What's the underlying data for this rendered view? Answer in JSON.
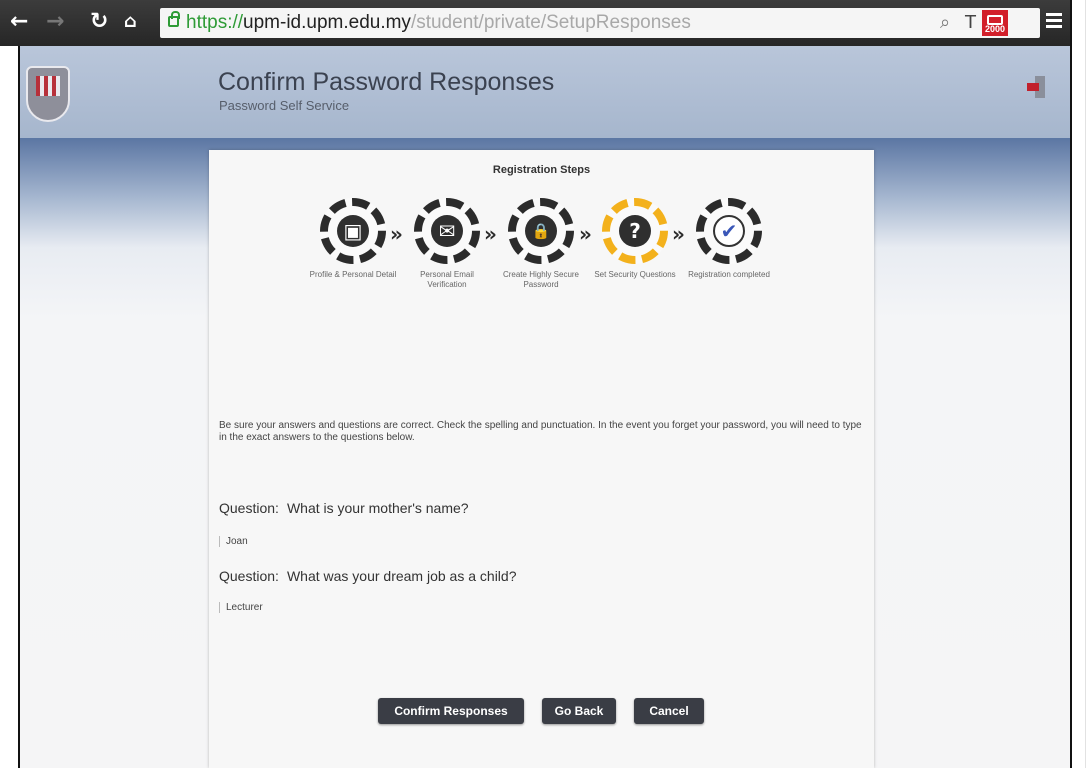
{
  "browser": {
    "url_scheme": "https://",
    "url_host": "upm-id.upm.edu.my",
    "url_path": "/student/private/SetupResponses",
    "ext_badge": "2000"
  },
  "header": {
    "title": "Confirm Password Responses",
    "subtitle": "Password Self Service"
  },
  "registration": {
    "title": "Registration Steps",
    "steps": [
      {
        "label": "Profile & Personal Detail",
        "icon": "profile-card-icon",
        "glyph": "▣",
        "state": "done"
      },
      {
        "label": "Personal Email Verification",
        "icon": "envelope-icon",
        "glyph": "✉",
        "state": "done"
      },
      {
        "label": "Create Highly Secure Password",
        "icon": "lock-shield-icon",
        "glyph": "🔒",
        "state": "done"
      },
      {
        "label": "Set Security Questions",
        "icon": "question-shield-icon",
        "glyph": "?",
        "state": "active"
      },
      {
        "label": "Registration completed",
        "icon": "checkmark-icon",
        "glyph": "✔",
        "state": "pending"
      }
    ]
  },
  "instructions": "Be sure your answers and questions are correct. Check the spelling and punctuation. In the event you forget your password, you will need to type in the exact answers to the questions below.",
  "questions": [
    {
      "prefix": "Question:",
      "text": "What is your mother's name?",
      "answer": "Joan"
    },
    {
      "prefix": "Question:",
      "text": "What was your dream job as a child?",
      "answer": "Lecturer"
    }
  ],
  "buttons": {
    "confirm": "Confirm Responses",
    "back": "Go Back",
    "cancel": "Cancel"
  },
  "colors": {
    "active_step": "#f3b11c",
    "button_bg": "#3a3d45",
    "header_bg": "#b9c6da"
  }
}
